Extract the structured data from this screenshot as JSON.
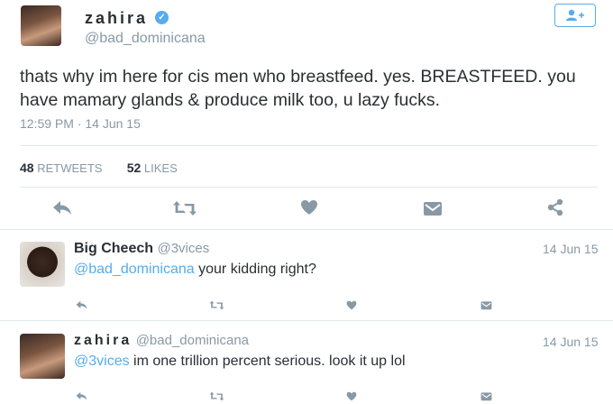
{
  "tweet": {
    "display_name": "zahira",
    "handle": "@bad_dominicana",
    "text": "thats why im here for cis men who breastfeed. yes. BREASTFEED. you have mamary glands & produce milk too, u lazy fucks.",
    "timestamp": "12:59 PM · 14 Jun 15",
    "retweets_count": "48",
    "retweets_label": "RETWEETS",
    "likes_count": "52",
    "likes_label": "LIKES"
  },
  "replies": [
    {
      "display_name": "Big Cheech",
      "handle": "@3vices",
      "date": "14 Jun 15",
      "mention": "@bad_dominicana",
      "text": " your kidding right?"
    },
    {
      "display_name": "zahira",
      "handle": "@bad_dominicana",
      "date": "14 Jun 15",
      "mention": "@3vices",
      "text": " im one trillion percent serious. look it up lol"
    }
  ],
  "colors": {
    "accent": "#55acee",
    "muted": "#8899a6",
    "text": "#292f33",
    "divider": "#e1e8ed"
  },
  "icons": [
    "verified-badge-icon",
    "follow-user-icon",
    "reply-icon",
    "retweet-icon",
    "like-icon",
    "message-icon",
    "share-icon"
  ]
}
